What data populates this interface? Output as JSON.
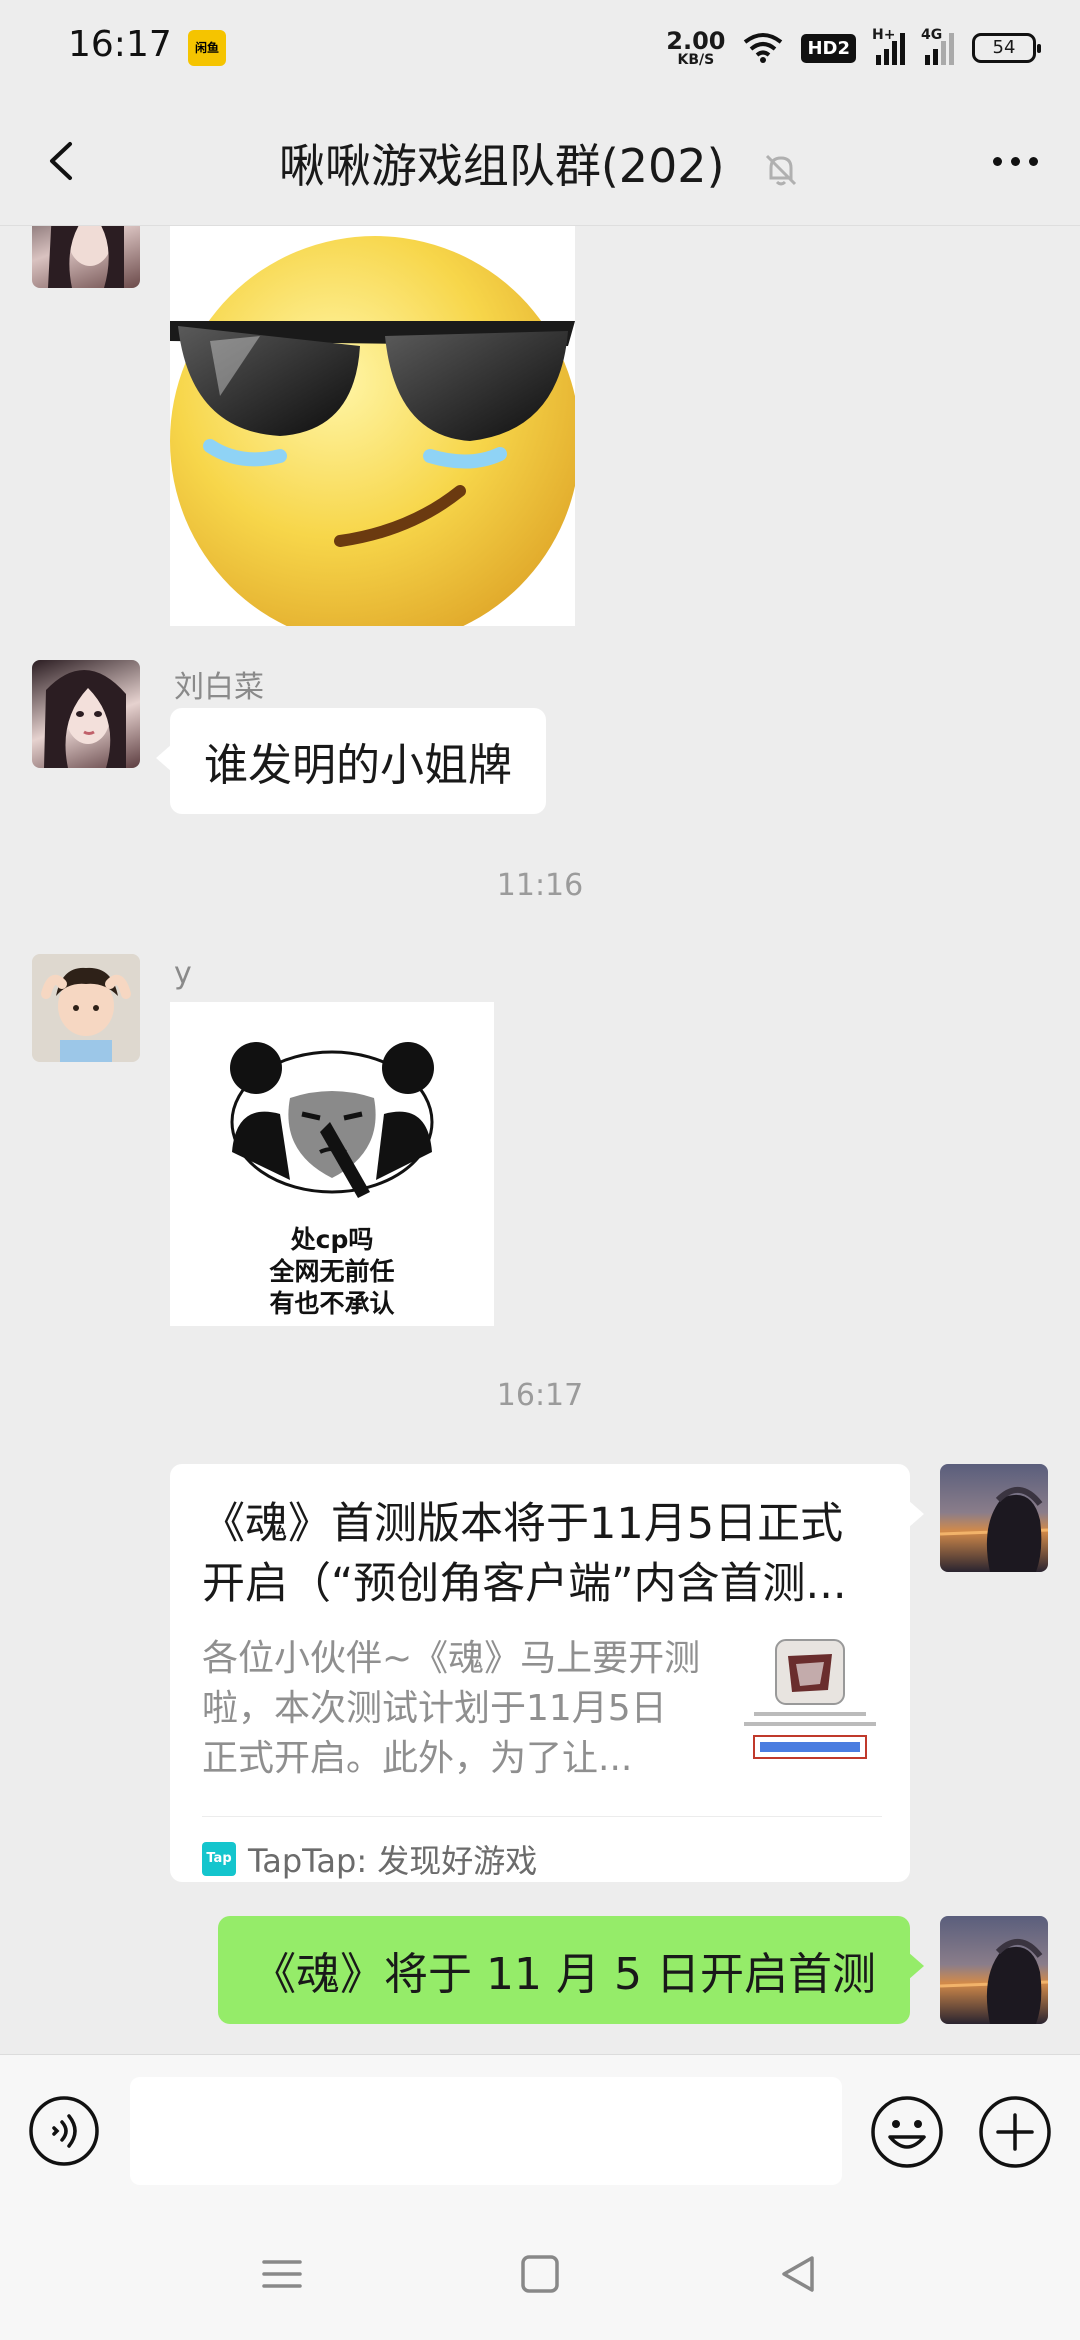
{
  "status_bar": {
    "time": "16:17",
    "app_icon_text": "闲鱼",
    "net_speed_value": "2.00",
    "net_speed_unit": "KB/S",
    "hd_label": "HD2",
    "signal1_label": "H+",
    "signal2_label": "4G",
    "battery": "54"
  },
  "header": {
    "title": "啾啾游戏组队群(202)"
  },
  "messages": {
    "sender_1": "刘白菜",
    "text_1": "谁发明的小姐牌",
    "time_1": "11:16",
    "sender_2": "y",
    "sticker_text_line1": "处cp吗",
    "sticker_text_line2": "全网无前任",
    "sticker_text_line3": "有也不承认",
    "time_2": "16:17",
    "link_card": {
      "title": "《魂》首测版本将于11月5日正式开启（“预创角客户端”内含首测...",
      "description": "各位小伙伴~《魂》马上要开测啦，本次测试计划于11月5日正式开启。此外，为了让...",
      "source": "TapTap: 发现好游戏",
      "logo_text": "Tap"
    },
    "my_text": "《魂》将于 11 月 5 日开启首测"
  },
  "input": {
    "placeholder": ""
  }
}
